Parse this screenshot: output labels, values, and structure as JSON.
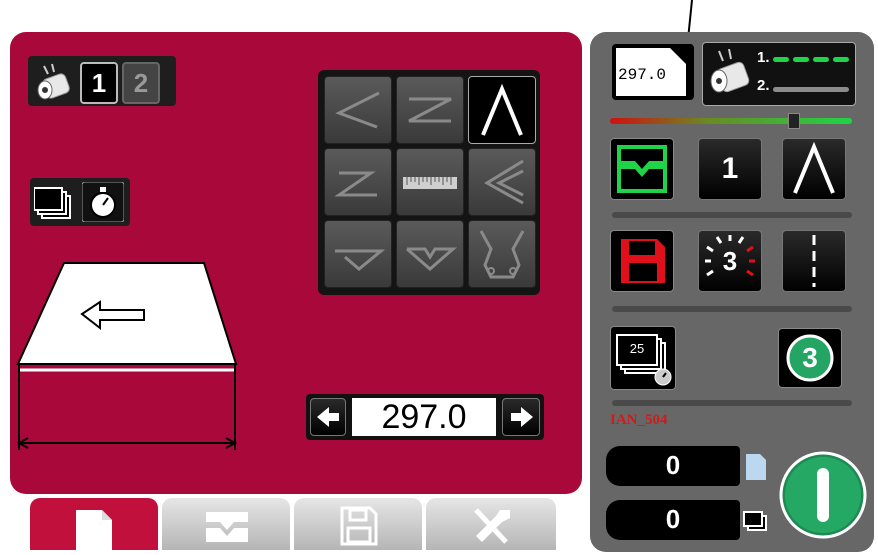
{
  "main": {
    "tool_selector": {
      "tool1": "1",
      "tool2": "2"
    },
    "length": {
      "value": "297.0"
    },
    "keypad_icons": [
      "bend-left-icon",
      "z-bend-icon",
      "v-bend-icon",
      "z-offset-icon",
      "ruler-icon",
      "double-bend-icon",
      "hem-flat-icon",
      "hem-v-icon",
      "gripper-icon"
    ]
  },
  "right": {
    "program_length": "297.0",
    "tool_lines": {
      "line1": "1.",
      "line2": "2."
    },
    "step_number": "1",
    "repeat_count": "3",
    "stack_count": "25",
    "badge_number": "3",
    "program_name": "IAN_504",
    "counter_top": "0",
    "counter_bottom": "0"
  },
  "colors": {
    "panel_red": "#a8093a",
    "panel_gray": "#676767",
    "accent_green": "#1fd447",
    "save_red": "#e0101a",
    "program_name_red": "#d21a1a"
  },
  "tabs": [
    "document-icon",
    "press-brake-icon",
    "save-icon",
    "tools-icon"
  ]
}
